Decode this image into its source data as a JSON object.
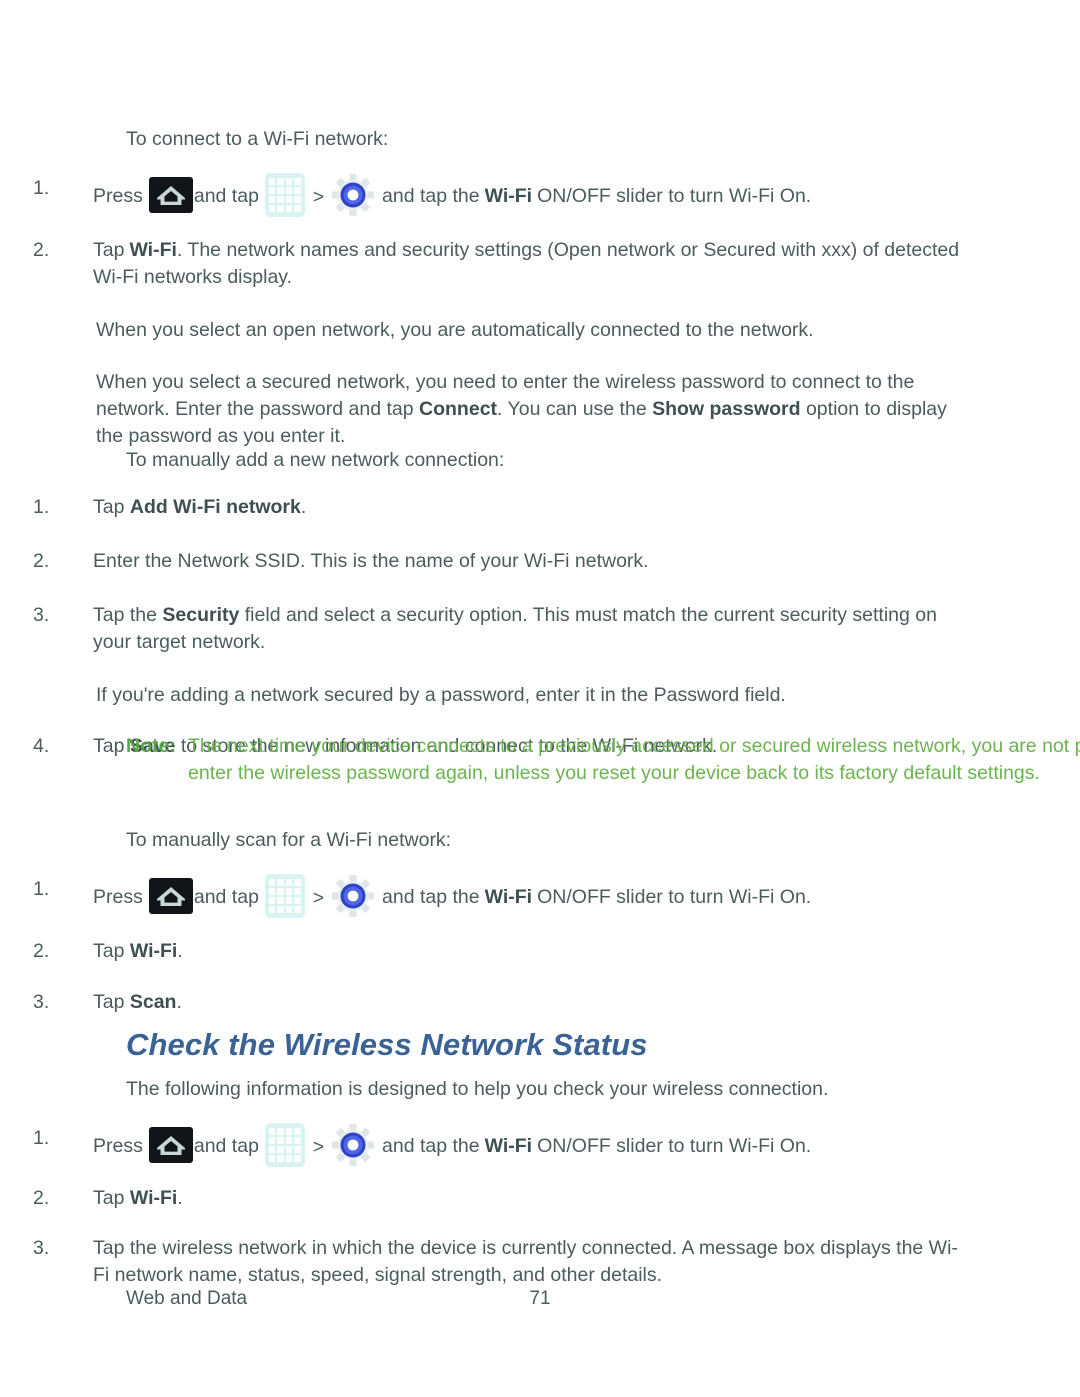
{
  "page": {
    "footer_left": "Web and Data",
    "footer_page_number": "71",
    "text_color": "#4c5c5e",
    "heading_color": "#3a6295",
    "note_label_color": "#57a546",
    "note_body_color": "#6cb44f"
  },
  "icons": {
    "home": "home-icon",
    "apps": "apps-grid-icon",
    "settings": "settings-gear-icon",
    "chevron": ">"
  },
  "intro": {
    "connect_lead": "To connect to a Wi-Fi network:"
  },
  "connect_steps": {
    "step1": {
      "num": "1.",
      "press_label": "Press",
      "and_tap_label": "and tap",
      "tail_pre": "and tap the",
      "wifi_bold": "Wi-Fi",
      "tail_post": "ON/OFF slider to turn Wi-Fi On."
    },
    "step2": {
      "num": "2.",
      "pre": "Tap",
      "bold": "Wi-Fi",
      "post": ". The network names and security settings (Open network or Secured with xxx) of detected Wi-Fi networks display."
    },
    "sub1": "When you select an open network, you are automatically connected to the network.",
    "sub2": {
      "part1": "When you select a secured network, you need to enter the wireless password to connect to the network. Enter the password and tap ",
      "bold1": "Connect",
      "part2": ". You can use the ",
      "bold2": "Show password",
      "part3": " option to display the password as you enter it."
    }
  },
  "manual_add": {
    "lead": "To manually add a new network connection:",
    "steps": [
      {
        "num": "1.",
        "pre": "Tap ",
        "bold": "Add Wi-Fi network",
        "post": "."
      },
      {
        "num": "2.",
        "pre": "Enter the Network SSID. This is the name of your Wi-Fi network.",
        "bold": "",
        "post": ""
      },
      {
        "num": "3.",
        "pre": "Tap the ",
        "bold": "Security",
        "post": " field and select a security option. This must match the current security setting on your target network."
      }
    ],
    "sub": "If you're adding a network secured by a password, enter it in the Password field.",
    "step4": {
      "num": "4.",
      "pre": "Tap ",
      "bold": "Save",
      "post": " to store the new information and connect to the Wi-Fi network."
    }
  },
  "note": {
    "label": "Note:",
    "body": "The next time your device connects to a previously accessed or secured wireless network, you are not prompted to enter the wireless password again, unless you reset your device back to its factory default settings."
  },
  "manual_scan": {
    "lead": "To manually scan for a Wi-Fi network:",
    "step1": {
      "num": "1.",
      "press_label": "Press",
      "and_tap_label": "and tap",
      "tail_pre": "and tap the",
      "wifi_bold": "Wi-Fi",
      "tail_post": "ON/OFF slider to turn Wi-Fi On."
    },
    "step2": {
      "num": "2.",
      "pre": "Tap ",
      "bold": " Wi-Fi",
      "post": "."
    },
    "step3": {
      "num": "3.",
      "pre": "Tap ",
      "bold": "Scan",
      "post": "."
    }
  },
  "check_status": {
    "title": "Check the Wireless Network Status",
    "lead": "The following information is designed to help you check your wireless connection.",
    "step1": {
      "num": "1.",
      "press_label": "Press",
      "and_tap_label": "and tap",
      "tail_pre": "and tap the",
      "wifi_bold": "Wi-Fi",
      "tail_post": "ON/OFF slider to turn Wi-Fi On."
    },
    "step2": {
      "num": "2.",
      "pre": "Tap ",
      "bold": "Wi-Fi",
      "post": "."
    },
    "step3": {
      "num": "3.",
      "text": "Tap the wireless network in which the device is currently connected. A message box displays the Wi-Fi network name, status, speed, signal strength, and other details."
    }
  }
}
